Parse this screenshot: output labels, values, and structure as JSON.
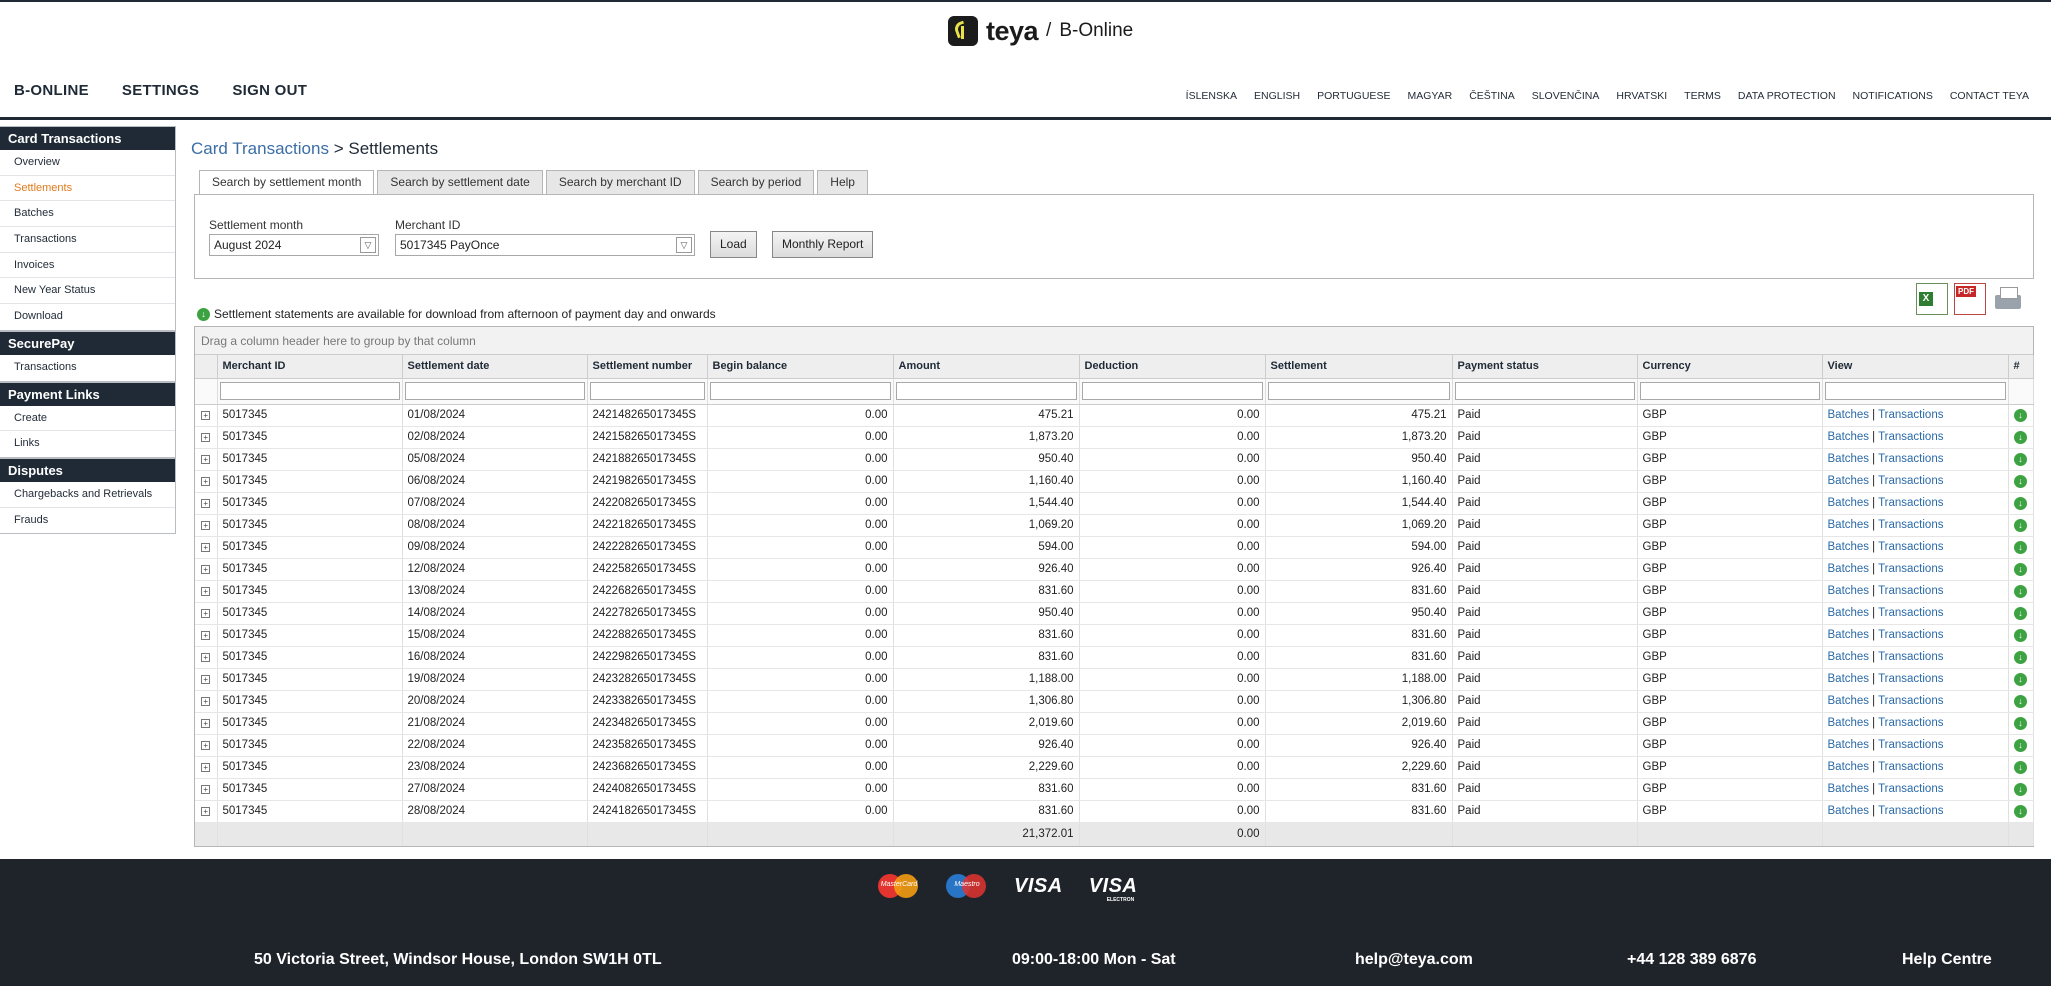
{
  "brand": {
    "name": "teya",
    "separator": "/",
    "product": "B-Online"
  },
  "main_nav": [
    "B-ONLINE",
    "SETTINGS",
    "SIGN OUT"
  ],
  "lang_nav": [
    "ÍSLENSKA",
    "ENGLISH",
    "PORTUGUESE",
    "MAGYAR",
    "ČEŠTINA",
    "SLOVENČINA",
    "HRVATSKI",
    "TERMS",
    "DATA PROTECTION",
    "NOTIFICATIONS",
    "CONTACT TEYA"
  ],
  "sidebar": [
    {
      "title": "Card Transactions",
      "items": [
        "Overview",
        "Settlements",
        "Batches",
        "Transactions",
        "Invoices",
        "New Year Status",
        "Download"
      ],
      "active": "Settlements"
    },
    {
      "title": "SecurePay",
      "items": [
        "Transactions"
      ]
    },
    {
      "title": "Payment Links",
      "items": [
        "Create",
        "Links"
      ]
    },
    {
      "title": "Disputes",
      "items": [
        "Chargebacks and Retrievals",
        "Frauds"
      ]
    }
  ],
  "breadcrumb": {
    "parent": "Card Transactions",
    "separator": ">",
    "current": "Settlements"
  },
  "tabs": [
    "Search by settlement month",
    "Search by settlement date",
    "Search by merchant ID",
    "Search by period",
    "Help"
  ],
  "active_tab": "Search by settlement month",
  "form": {
    "month_label": "Settlement month",
    "month_value": "August 2024",
    "merchant_label": "Merchant ID",
    "merchant_value": "5017345 PayOnce",
    "load_button": "Load",
    "report_button": "Monthly Report"
  },
  "toolbar_icons": [
    "excel-export-icon",
    "pdf-export-icon",
    "print-icon"
  ],
  "note": "Settlement statements are available for download from afternoon of payment day and onwards",
  "grid": {
    "group_hint": "Drag a column header here to group by that column",
    "columns": [
      "Merchant ID",
      "Settlement date",
      "Settlement number",
      "Begin balance",
      "Amount",
      "Deduction",
      "Settlement",
      "Payment status",
      "Currency",
      "View",
      "#"
    ],
    "view_links": {
      "batches": "Batches",
      "separator": "|",
      "transactions": "Transactions"
    },
    "rows": [
      {
        "merchant": "5017345",
        "date": "01/08/2024",
        "number": "24214826501734​5S",
        "begin": "0.00",
        "amount": "475.21",
        "deduction": "0.00",
        "settlement": "475.21",
        "status": "Paid",
        "currency": "GBP"
      },
      {
        "merchant": "5017345",
        "date": "02/08/2024",
        "number": "242158265017345S",
        "begin": "0.00",
        "amount": "1,873.20",
        "deduction": "0.00",
        "settlement": "1,873.20",
        "status": "Paid",
        "currency": "GBP"
      },
      {
        "merchant": "5017345",
        "date": "05/08/2024",
        "number": "242188265017345S",
        "begin": "0.00",
        "amount": "950.40",
        "deduction": "0.00",
        "settlement": "950.40",
        "status": "Paid",
        "currency": "GBP"
      },
      {
        "merchant": "5017345",
        "date": "06/08/2024",
        "number": "242198265017345S",
        "begin": "0.00",
        "amount": "1,160.40",
        "deduction": "0.00",
        "settlement": "1,160.40",
        "status": "Paid",
        "currency": "GBP"
      },
      {
        "merchant": "5017345",
        "date": "07/08/2024",
        "number": "242208265017345S",
        "begin": "0.00",
        "amount": "1,544.40",
        "deduction": "0.00",
        "settlement": "1,544.40",
        "status": "Paid",
        "currency": "GBP"
      },
      {
        "merchant": "5017345",
        "date": "08/08/2024",
        "number": "242218265017345S",
        "begin": "0.00",
        "amount": "1,069.20",
        "deduction": "0.00",
        "settlement": "1,069.20",
        "status": "Paid",
        "currency": "GBP"
      },
      {
        "merchant": "5017345",
        "date": "09/08/2024",
        "number": "242228265017345S",
        "begin": "0.00",
        "amount": "594.00",
        "deduction": "0.00",
        "settlement": "594.00",
        "status": "Paid",
        "currency": "GBP"
      },
      {
        "merchant": "5017345",
        "date": "12/08/2024",
        "number": "242258265017345S",
        "begin": "0.00",
        "amount": "926.40",
        "deduction": "0.00",
        "settlement": "926.40",
        "status": "Paid",
        "currency": "GBP"
      },
      {
        "merchant": "5017345",
        "date": "13/08/2024",
        "number": "242268265017345S",
        "begin": "0.00",
        "amount": "831.60",
        "deduction": "0.00",
        "settlement": "831.60",
        "status": "Paid",
        "currency": "GBP"
      },
      {
        "merchant": "5017345",
        "date": "14/08/2024",
        "number": "242278265017345S",
        "begin": "0.00",
        "amount": "950.40",
        "deduction": "0.00",
        "settlement": "950.40",
        "status": "Paid",
        "currency": "GBP"
      },
      {
        "merchant": "5017345",
        "date": "15/08/2024",
        "number": "242288265017345S",
        "begin": "0.00",
        "amount": "831.60",
        "deduction": "0.00",
        "settlement": "831.60",
        "status": "Paid",
        "currency": "GBP"
      },
      {
        "merchant": "5017345",
        "date": "16/08/2024",
        "number": "242298265017345S",
        "begin": "0.00",
        "amount": "831.60",
        "deduction": "0.00",
        "settlement": "831.60",
        "status": "Paid",
        "currency": "GBP"
      },
      {
        "merchant": "5017345",
        "date": "19/08/2024",
        "number": "242328265017345S",
        "begin": "0.00",
        "amount": "1,188.00",
        "deduction": "0.00",
        "settlement": "1,188.00",
        "status": "Paid",
        "currency": "GBP"
      },
      {
        "merchant": "5017345",
        "date": "20/08/2024",
        "number": "242338265017345S",
        "begin": "0.00",
        "amount": "1,306.80",
        "deduction": "0.00",
        "settlement": "1,306.80",
        "status": "Paid",
        "currency": "GBP"
      },
      {
        "merchant": "5017345",
        "date": "21/08/2024",
        "number": "242348265017345S",
        "begin": "0.00",
        "amount": "2,019.60",
        "deduction": "0.00",
        "settlement": "2,019.60",
        "status": "Paid",
        "currency": "GBP"
      },
      {
        "merchant": "5017345",
        "date": "22/08/2024",
        "number": "242358265017345S",
        "begin": "0.00",
        "amount": "926.40",
        "deduction": "0.00",
        "settlement": "926.40",
        "status": "Paid",
        "currency": "GBP"
      },
      {
        "merchant": "5017345",
        "date": "23/08/2024",
        "number": "242368265017345S",
        "begin": "0.00",
        "amount": "2,229.60",
        "deduction": "0.00",
        "settlement": "2,229.60",
        "status": "Paid",
        "currency": "GBP"
      },
      {
        "merchant": "5017345",
        "date": "27/08/2024",
        "number": "242408265017345S",
        "begin": "0.00",
        "amount": "831.60",
        "deduction": "0.00",
        "settlement": "831.60",
        "status": "Paid",
        "currency": "GBP"
      },
      {
        "merchant": "5017345",
        "date": "28/08/2024",
        "number": "242418265017345S",
        "begin": "0.00",
        "amount": "831.60",
        "deduction": "0.00",
        "settlement": "831.60",
        "status": "Paid",
        "currency": "GBP"
      }
    ],
    "totals": {
      "amount": "21,372.01",
      "deduction": "0.00"
    }
  },
  "footer": {
    "cards": [
      "MasterCard",
      "Maestro",
      "VISA",
      "VISA"
    ],
    "electron_label": "ELECTRON",
    "address": "50 Victoria Street, Windsor House, London SW1H 0TL",
    "hours": "09:00-18:00 Mon - Sat",
    "email": "help@teya.com",
    "phone": "+44 128 389 6876",
    "help": "Help Centre"
  },
  "colors": {
    "navy": "#1f2a36",
    "active_orange": "#e07a1c",
    "link_blue": "#2a6aa8",
    "download_green": "#3da342",
    "footer_bg": "#1f242b"
  }
}
